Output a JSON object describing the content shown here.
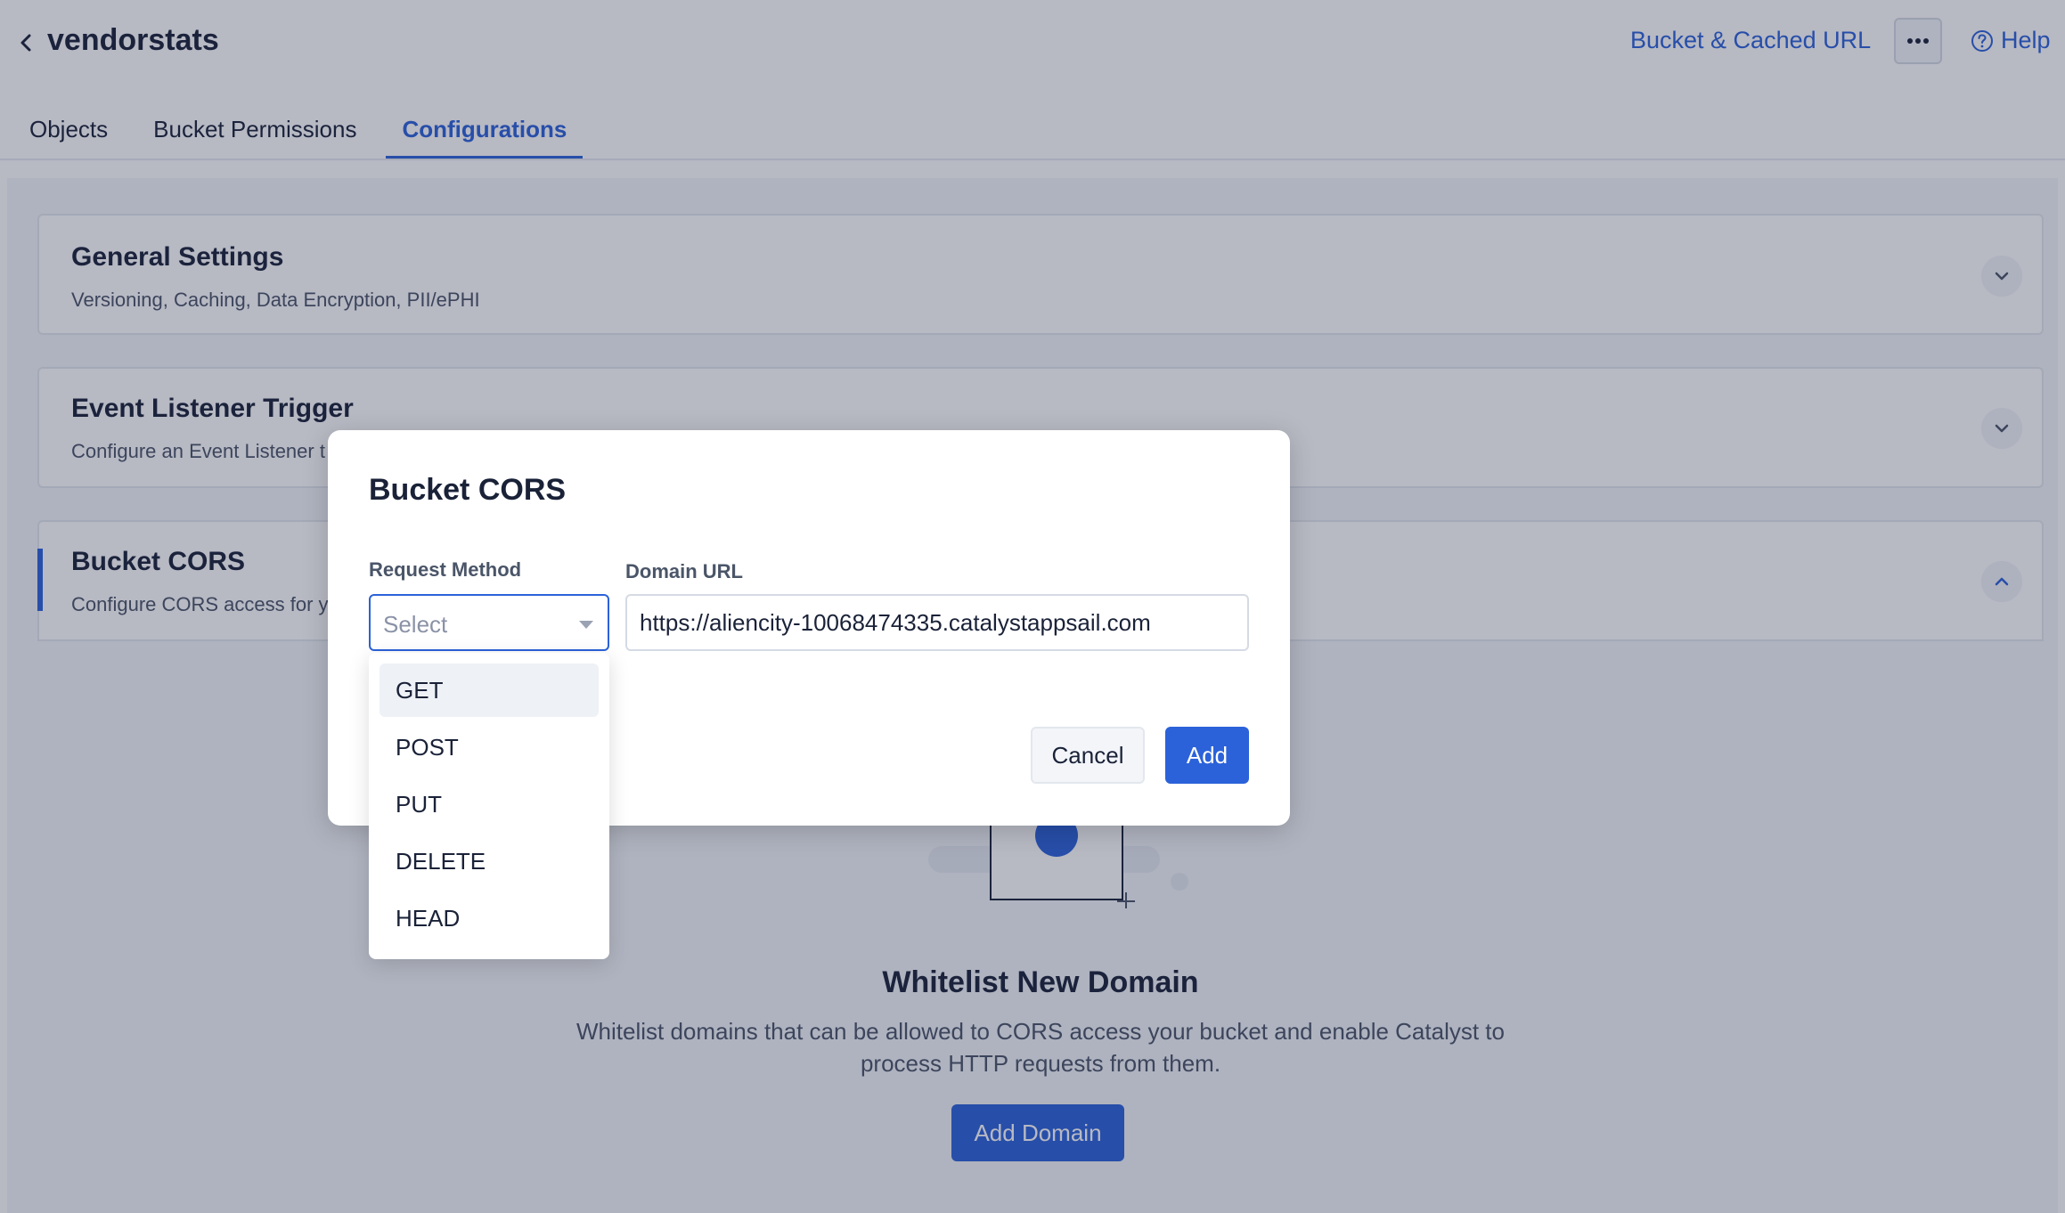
{
  "header": {
    "title": "vendorstats",
    "bucket_url_label": "Bucket & Cached URL",
    "more_label": "•••",
    "help_label": "Help"
  },
  "tabs": [
    {
      "label": "Objects"
    },
    {
      "label": "Bucket Permissions"
    },
    {
      "label": "Configurations",
      "active": true
    }
  ],
  "sections": {
    "general": {
      "title": "General Settings",
      "subtitle": "Versioning, Caching, Data Encryption, PII/ePHI"
    },
    "event": {
      "title": "Event Listener Trigger",
      "subtitle": "Configure an Event Listener t"
    },
    "cors": {
      "title": "Bucket CORS",
      "subtitle": "Configure CORS access for y"
    }
  },
  "empty_state": {
    "title": "Whitelist New Domain",
    "description": "Whitelist domains that can be allowed to CORS access your bucket and enable Catalyst to process HTTP requests from them.",
    "button_label": "Add Domain"
  },
  "modal": {
    "title": "Bucket CORS",
    "method_label": "Request Method",
    "method_placeholder": "Select",
    "domain_label": "Domain URL",
    "domain_value": "https://aliencity-10068474335.catalystappsail.com",
    "cancel_label": "Cancel",
    "add_label": "Add"
  },
  "dropdown": {
    "options": [
      "GET",
      "POST",
      "PUT",
      "DELETE",
      "HEAD"
    ],
    "hovered": "GET"
  },
  "colors": {
    "accent": "#2b62d9",
    "text": "#1a2238"
  }
}
